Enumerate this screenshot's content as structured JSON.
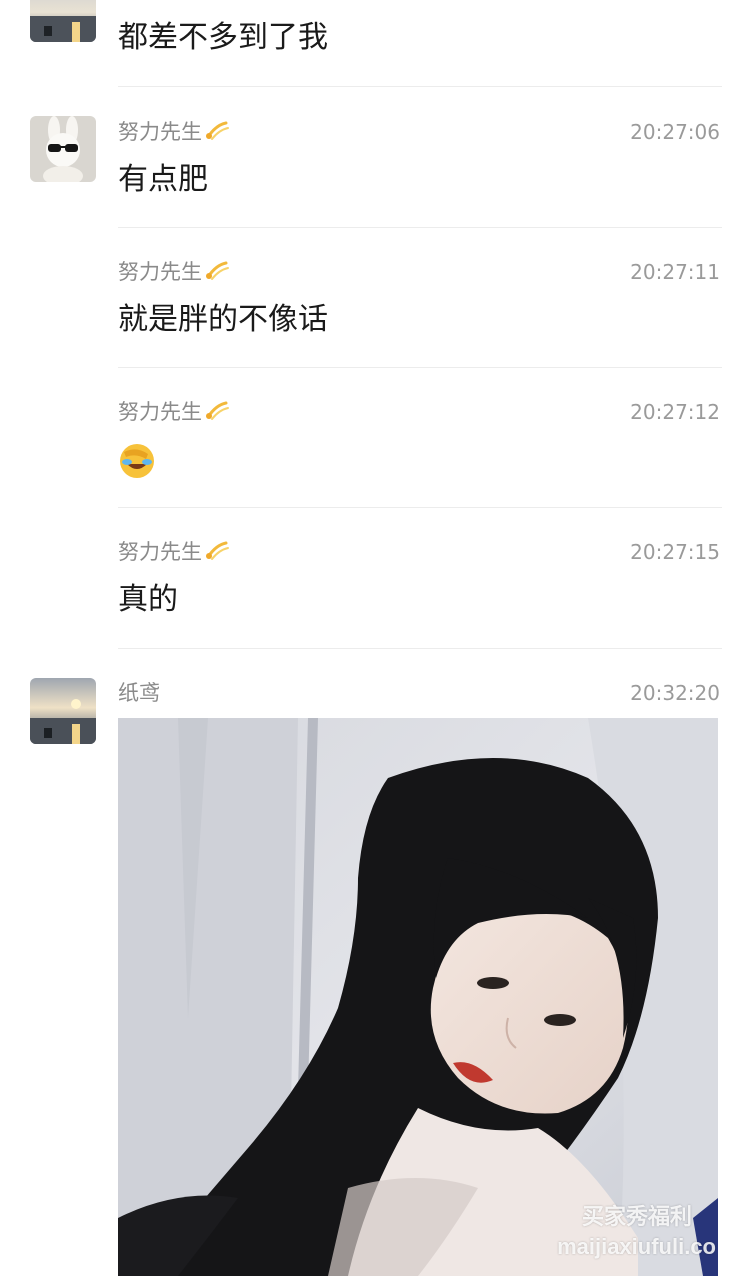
{
  "messages": [
    {
      "sender": "",
      "time": "",
      "text": "都差不多到了我"
    },
    {
      "sender": "努力先生",
      "time": "20:27:06",
      "text": "有点肥"
    },
    {
      "sender": "努力先生",
      "time": "20:27:11",
      "text": "就是胖的不像话"
    },
    {
      "sender": "努力先生",
      "time": "20:27:12",
      "emoji": "facepalm-laughing-emoji"
    },
    {
      "sender": "努力先生",
      "time": "20:27:15",
      "text": "真的"
    },
    {
      "sender": "纸鸢",
      "time": "20:32:20",
      "image": "selfie-photo"
    }
  ],
  "icons": {
    "sender_badge": "dizzy-comet-icon",
    "avatar_1": "sunset-lake-avatar",
    "avatar_2": "bunny-sunglasses-avatar"
  },
  "watermark": {
    "line1": "买家秀福利",
    "line2": "maijiaxiufuli.co"
  },
  "colors": {
    "background": "#ffffff",
    "text": "#1a1a1a",
    "meta": "#8a8a8a",
    "divider": "#ececec"
  }
}
